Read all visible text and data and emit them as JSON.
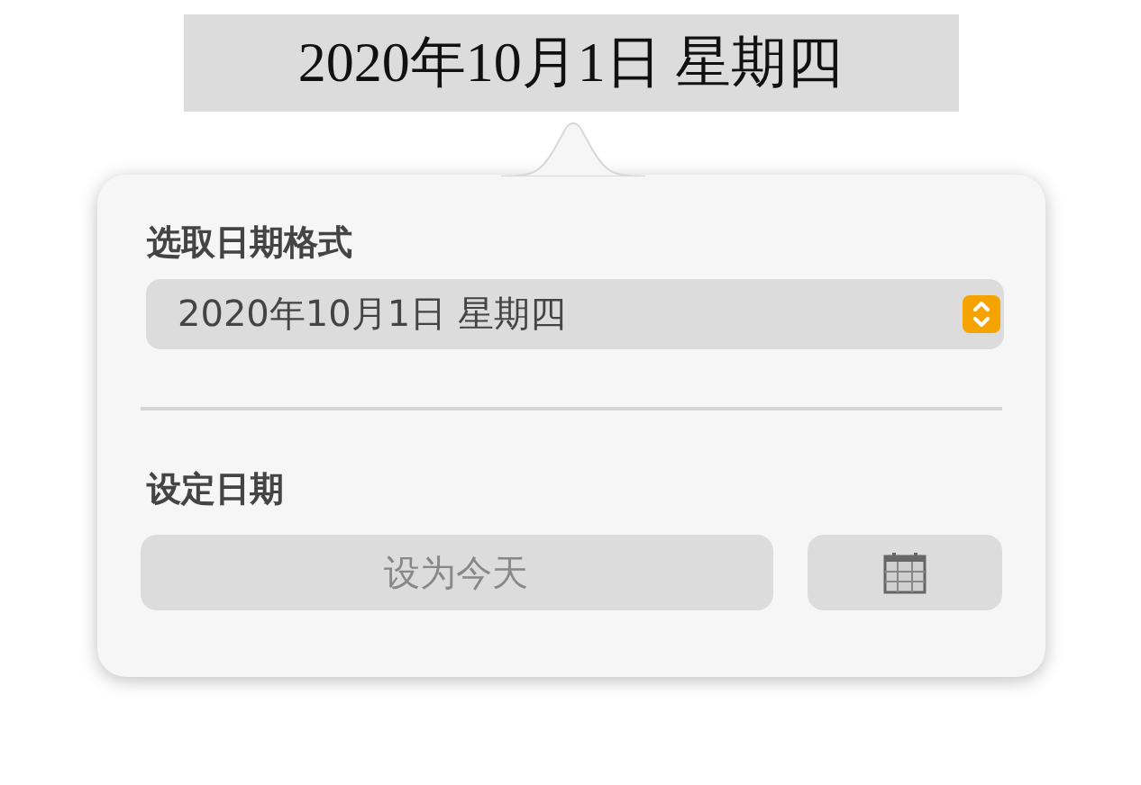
{
  "selected_text": "2020年10月1日 星期四",
  "popover": {
    "format_section": {
      "label": "选取日期格式",
      "value": "2020年10月1日 星期四"
    },
    "date_section": {
      "label": "设定日期",
      "today_button": {
        "label": "设为今天",
        "disabled": true
      }
    }
  }
}
